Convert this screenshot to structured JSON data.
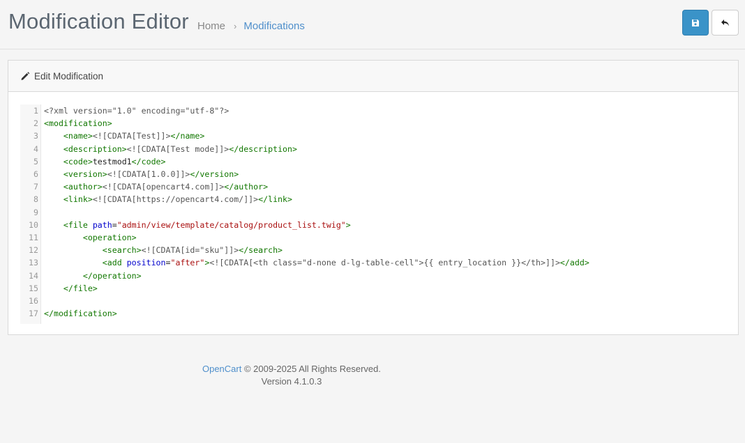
{
  "header": {
    "title": "Modification Editor",
    "breadcrumb": {
      "home": "Home",
      "separator": "›",
      "current": "Modifications"
    }
  },
  "buttons": {
    "save_icon": "save-icon",
    "back_icon": "reply-icon"
  },
  "card": {
    "title": "Edit Modification",
    "icon": "pencil-icon"
  },
  "code_lines": [
    [
      {
        "t": "<?xml version=\"1.0\" encoding=\"utf-8\"?>",
        "c": "meta"
      }
    ],
    [
      {
        "t": "<modification>",
        "c": "tag"
      }
    ],
    [
      {
        "t": "    ",
        "c": "plain"
      },
      {
        "t": "<name>",
        "c": "tag"
      },
      {
        "t": "<![CDATA[Test]]>",
        "c": "cdata"
      },
      {
        "t": "</name>",
        "c": "tag"
      }
    ],
    [
      {
        "t": "    ",
        "c": "plain"
      },
      {
        "t": "<description>",
        "c": "tag"
      },
      {
        "t": "<![CDATA[Test mode]]>",
        "c": "cdata"
      },
      {
        "t": "</description>",
        "c": "tag"
      }
    ],
    [
      {
        "t": "    ",
        "c": "plain"
      },
      {
        "t": "<code>",
        "c": "tag"
      },
      {
        "t": "testmod1",
        "c": "plain"
      },
      {
        "t": "</code>",
        "c": "tag"
      }
    ],
    [
      {
        "t": "    ",
        "c": "plain"
      },
      {
        "t": "<version>",
        "c": "tag"
      },
      {
        "t": "<![CDATA[1.0.0]]>",
        "c": "cdata"
      },
      {
        "t": "</version>",
        "c": "tag"
      }
    ],
    [
      {
        "t": "    ",
        "c": "plain"
      },
      {
        "t": "<author>",
        "c": "tag"
      },
      {
        "t": "<![CDATA[opencart4.com]]>",
        "c": "cdata"
      },
      {
        "t": "</author>",
        "c": "tag"
      }
    ],
    [
      {
        "t": "    ",
        "c": "plain"
      },
      {
        "t": "<link>",
        "c": "tag"
      },
      {
        "t": "<![CDATA[https://opencart4.com/]]>",
        "c": "cdata"
      },
      {
        "t": "</link>",
        "c": "tag"
      }
    ],
    [],
    [
      {
        "t": "    ",
        "c": "plain"
      },
      {
        "t": "<file ",
        "c": "tag"
      },
      {
        "t": "path",
        "c": "attr"
      },
      {
        "t": "=",
        "c": "plain"
      },
      {
        "t": "\"admin/view/template/catalog/product_list.twig\"",
        "c": "str"
      },
      {
        "t": ">",
        "c": "tag"
      }
    ],
    [
      {
        "t": "        ",
        "c": "plain"
      },
      {
        "t": "<operation>",
        "c": "tag"
      }
    ],
    [
      {
        "t": "            ",
        "c": "plain"
      },
      {
        "t": "<search>",
        "c": "tag"
      },
      {
        "t": "<![CDATA[id=\"sku\"]]>",
        "c": "cdata"
      },
      {
        "t": "</search>",
        "c": "tag"
      }
    ],
    [
      {
        "t": "            ",
        "c": "plain"
      },
      {
        "t": "<add ",
        "c": "tag"
      },
      {
        "t": "position",
        "c": "attr"
      },
      {
        "t": "=",
        "c": "plain"
      },
      {
        "t": "\"after\"",
        "c": "str"
      },
      {
        "t": ">",
        "c": "tag"
      },
      {
        "t": "<![CDATA[<th class=\"d-none d-lg-table-cell\">{{ entry_location }}</th>]]>",
        "c": "cdata"
      },
      {
        "t": "</add>",
        "c": "tag"
      }
    ],
    [
      {
        "t": "        ",
        "c": "plain"
      },
      {
        "t": "</operation>",
        "c": "tag"
      }
    ],
    [
      {
        "t": "    ",
        "c": "plain"
      },
      {
        "t": "</file>",
        "c": "tag"
      }
    ],
    [],
    [
      {
        "t": "</modification>",
        "c": "tag"
      }
    ]
  ],
  "footer": {
    "brand": "OpenCart",
    "copyright": " © 2009-2025 All Rights Reserved.",
    "version": "Version 4.1.0.3"
  }
}
